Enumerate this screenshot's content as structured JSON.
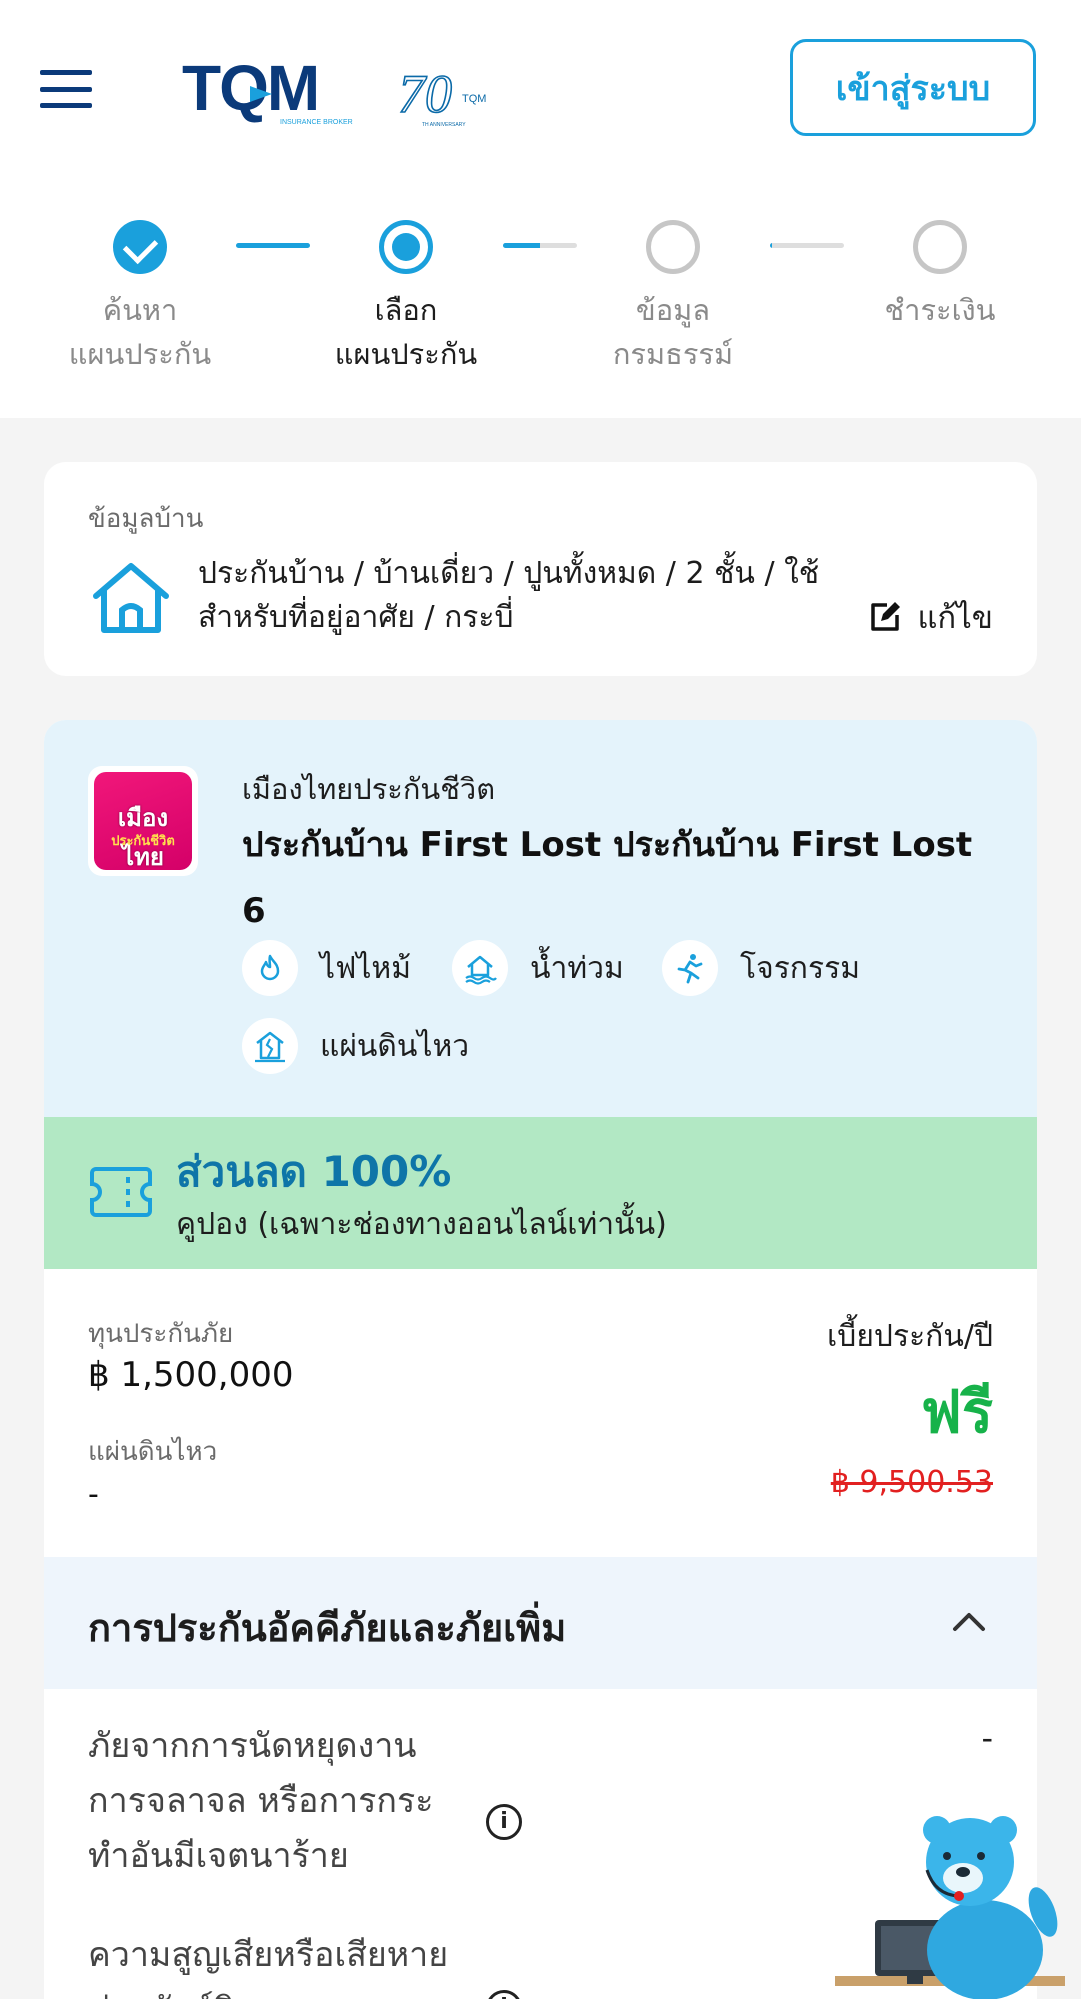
{
  "header": {
    "login_label": "เข้าสู่ระบบ",
    "brand_primary": "#0b3a7a",
    "brand_accent": "#1aa0dc"
  },
  "stepper": {
    "steps": [
      {
        "line1": "ค้นหา",
        "line2": "แผนประกัน",
        "state": "done"
      },
      {
        "line1": "เลือก",
        "line2": "แผนประกัน",
        "state": "current"
      },
      {
        "line1": "ข้อมูล",
        "line2": "กรมธรรม์",
        "state": "todo"
      },
      {
        "line1": "ชำระเงิน",
        "line2": "",
        "state": "todo"
      }
    ],
    "connector_progress": [
      1.0,
      0.5,
      0.03
    ]
  },
  "house_info": {
    "title": "ข้อมูลบ้าน",
    "description": "ประกันบ้าน / บ้านเดี่ยว / ปูนทั้งหมด / 2 ชั้น / ใช้สำหรับที่อยู่อาศัย / กระบี่",
    "edit_label": "แก้ไข",
    "icon": "house-icon"
  },
  "plan": {
    "insurer_name": "เมืองไทยประกันชีวิต",
    "insurer_logo_line1": "เมืองไทย",
    "insurer_logo_line2": "ประกันชีวิต",
    "plan_name": "ประกันบ้าน First Lost ประกันบ้าน First Lost 6",
    "coverages": [
      {
        "label": "ไฟไหม้",
        "icon": "fire-icon"
      },
      {
        "label": "น้ำท่วม",
        "icon": "flood-icon"
      },
      {
        "label": "โจรกรรม",
        "icon": "theft-icon"
      },
      {
        "label": "แผ่นดินไหว",
        "icon": "earthquake-icon"
      }
    ],
    "discount_amount": "ส่วนลด 100%",
    "discount_note": "คูปอง (เฉพาะช่องทางออนไลน์เท่านั้น)",
    "sum_insured_label": "ทุนประกันภัย",
    "sum_insured_value": "฿ 1,500,000",
    "earthquake_label": "แผ่นดินไหว",
    "earthquake_value": "-",
    "premium_label": "เบี้ยประกัน/ปี",
    "premium_value": "ฟรี",
    "premium_original": "฿ 9,500.53",
    "free_color": "#17b24a",
    "strike_color": "#e22020"
  },
  "section": {
    "title": "การประกันอัคคีภัยและภัยเพิ่ม",
    "rows": [
      {
        "text": "ภัยจากการนัดหยุดงาน การจลาจล หรือการกระทำอันมีเจตนาร้าย",
        "value": "-"
      },
      {
        "text": "ความสูญเสียหรือเสียหายต่อทรัพย์สิน",
        "value": ""
      }
    ]
  }
}
